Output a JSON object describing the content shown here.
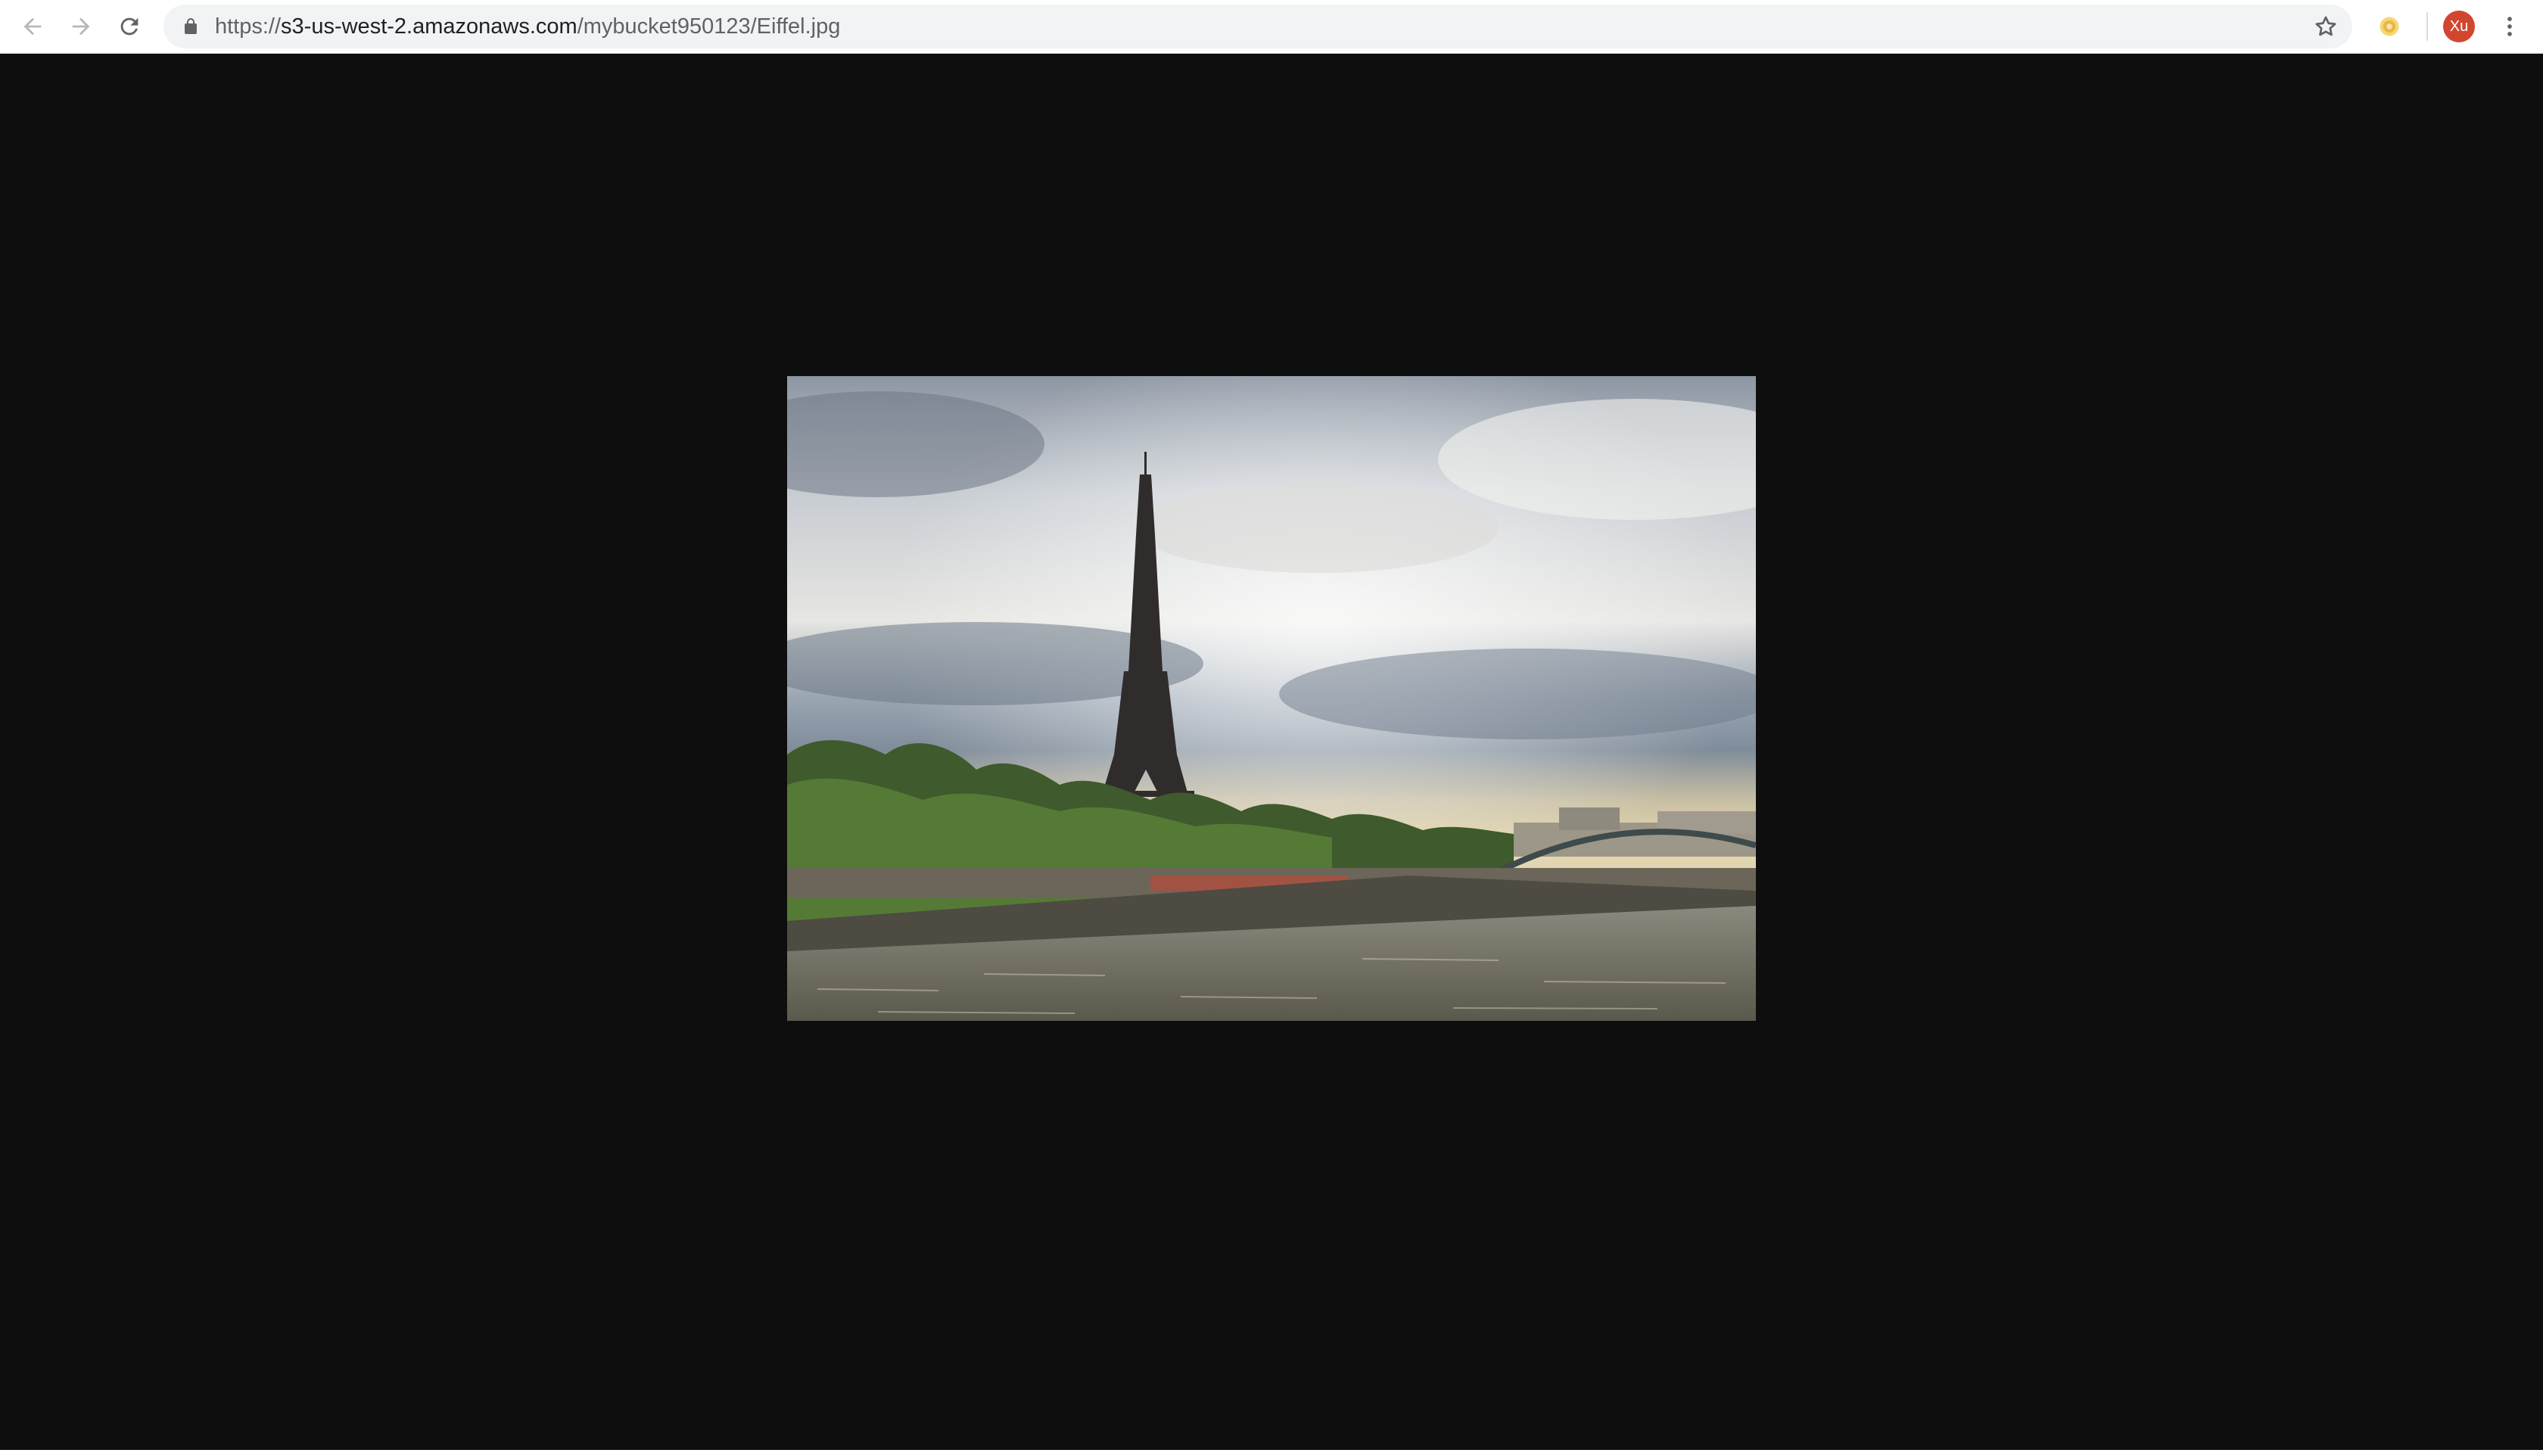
{
  "browser": {
    "url": {
      "scheme": "https://",
      "host": "s3-us-west-2.amazonaws.com",
      "path": "/mybucket950123/Eiffel.jpg"
    },
    "profile_initials": "Xu"
  },
  "icons": {
    "back": "arrow-left-icon",
    "forward": "arrow-right-icon",
    "reload": "reload-icon",
    "lock": "lock-icon",
    "bookmark": "star-icon",
    "extension": "extension-icon",
    "menu": "kebab-menu-icon"
  },
  "colors": {
    "page_background": "#0e0e0e",
    "omnibox_background": "#f1f3f4",
    "avatar": "#d1462f"
  },
  "image": {
    "subject": "Eiffel Tower above the Seine river under a cloudy sky"
  }
}
